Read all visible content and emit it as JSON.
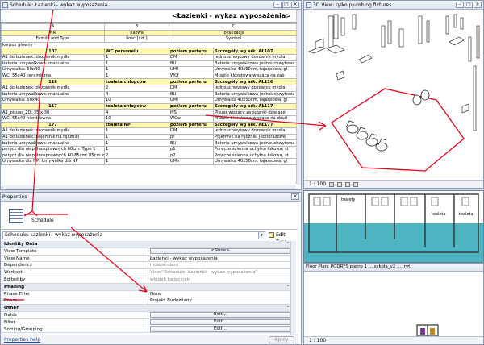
{
  "schedule": {
    "window_title": "Schedule: Łazienki - wykaz wyposażenia",
    "heading": "<Łazienki - wykaz wyposażenia>",
    "columns": [
      "A",
      "B",
      "C"
    ],
    "header_row1": [
      "NR",
      "nazwa",
      "lokalizacja"
    ],
    "header_row2": [
      "Family and Type",
      "ilość [szt.]",
      "Symbol"
    ],
    "group_label": "korpus główny",
    "rows": [
      {
        "type": "grp",
        "cells": [
          "107",
          "WC personelu",
          "poziom parteru",
          "Szczegóły wg ark. AŁ107"
        ]
      },
      {
        "type": "item",
        "cells": [
          "A1 do łazienek: dozownik mydła",
          "1",
          "DM",
          "Jednouchwytowy dozownik mydła"
        ]
      },
      {
        "type": "item",
        "cells": [
          "bateria umywalkowa: manualna",
          "1",
          "BU",
          "Bateria umywalkowa jednouchwytowa"
        ]
      },
      {
        "type": "item",
        "cells": [
          "Umywalka: 50x40",
          "1",
          "UMf",
          "Umywalka 40x50cm, fajansowa, gl"
        ]
      },
      {
        "type": "item",
        "cells": [
          "WC: 55x40 ceramiczna",
          "1",
          "WCf",
          "Muszle klozetowa wisząca na zab"
        ]
      },
      {
        "type": "grp",
        "cells": [
          "116",
          "toaleta chłopców",
          "poziom parteru",
          "Szczegóły wg ark. AŁ116"
        ]
      },
      {
        "type": "item",
        "cells": [
          "A1 do łazienek: dozownik mydła",
          "2",
          "DM",
          "Jednouchwytowy dozownik mydła"
        ]
      },
      {
        "type": "item",
        "cells": [
          "bateria umywalkowa: manualna",
          "4",
          "BU",
          "Bateria umywalkowa jednouchwytowa"
        ]
      },
      {
        "type": "item",
        "cells": [
          "Umywalka: 50x40",
          "10",
          "UMf",
          "Umywalka 40x50cm, fajansowa, gl"
        ]
      },
      {
        "type": "grp",
        "cells": [
          "117",
          "toaleta chłopców",
          "poziom parteru",
          "Szczegóły wg ark. AŁ117"
        ]
      },
      {
        "type": "item",
        "cells": [
          "A1_pisuar_2D: 35 x 30",
          "4",
          "PIS",
          "Pisuar wiszący ze ścianki dzielącej"
        ]
      },
      {
        "type": "item",
        "cells": [
          "WC: 55x40 nierdzewna",
          "10",
          "WCw",
          "Muszle klozetowa wisząca na zbud"
        ]
      },
      {
        "type": "grp",
        "cells": [
          "177",
          "toaleta NP",
          "poziom parteru",
          "Szczegóły wg ark. AŁ177"
        ]
      },
      {
        "type": "item",
        "cells": [
          "A1 do łazienek: dozownik mydła",
          "1",
          "DM",
          "Jednouchwytowy dozownik mydła"
        ]
      },
      {
        "type": "item",
        "cells": [
          "A1 do łazienek: pojemnik na ręczniki",
          "1",
          "pr",
          "Pojemnik na ręczniki jednorazowe"
        ]
      },
      {
        "type": "item",
        "cells": [
          "bateria umywalkowa: manualna",
          "1",
          "BU",
          "Bateria umywalkowa jednouchwytowa"
        ]
      },
      {
        "type": "item",
        "cells": [
          "poręcz dla niepełnosprawnych 60cm: Type 1",
          "1",
          "p1",
          "Poręcze ścienna uchylna łukowa, st"
        ]
      },
      {
        "type": "item",
        "cells": [
          "poręcz dla niepełnosprawnych 60-85cm: 85cm z",
          "2",
          "p2",
          "Poręcze ścienna uchylna łukowa, st"
        ]
      },
      {
        "type": "item",
        "cells": [
          "Umywalka dla NP: Umywalka dla NP",
          "1",
          "UMn",
          "Umywalka 40x50cm, fajansowa, gl"
        ]
      }
    ]
  },
  "view3d": {
    "window_title": "3D View: tylko plumbing fixtures",
    "scale": "1 : 100"
  },
  "properties": {
    "window_title": "Properties",
    "type_name": "Schedule",
    "instance_select": "Schedule: Łazienki - wykaz wyposażenia",
    "edit_type_label": "Edit Type",
    "rows": [
      {
        "type": "sec",
        "k": "Identity Data"
      },
      {
        "type": "row",
        "k": "View Template",
        "v": "<None>",
        "button": true
      },
      {
        "type": "row",
        "k": "View Name",
        "v": "Łazienki - wykaz wyposażenia"
      },
      {
        "type": "dis",
        "k": "Dependency",
        "v": "Independent"
      },
      {
        "type": "dis",
        "k": "Workset",
        "v": "View \"Schedule: Łazienki - wykaz wyposażenia\""
      },
      {
        "type": "dis",
        "k": "Edited by",
        "v": "włodek.kwiecinski"
      },
      {
        "type": "sec",
        "k": "Phasing"
      },
      {
        "type": "row",
        "k": "Phase Filter",
        "v": "None"
      },
      {
        "type": "row",
        "k": "Phase",
        "v": "Projekt Budowlany"
      },
      {
        "type": "sec",
        "k": "Other"
      },
      {
        "type": "row",
        "k": "Fields",
        "v": "Edit...",
        "button": true
      },
      {
        "type": "row",
        "k": "Filter",
        "v": "Edit...",
        "button": true
      },
      {
        "type": "row",
        "k": "Sorting/Grouping",
        "v": "Edit...",
        "button": true
      }
    ],
    "help_link": "Properties help",
    "apply_label": "Apply"
  },
  "floorplan": {
    "window_title": "Floor Plan: PODRYS piętro 1 ... szkoła_v2 ... .rvt",
    "scale": "1 : 100",
    "room_labels": [
      "toalety",
      "toaleta",
      "toaleta"
    ]
  },
  "colors": {
    "annotation_red": "#e3001b",
    "group_yellow": "#fff9b0",
    "floor_teal": "#2ea7b6"
  }
}
